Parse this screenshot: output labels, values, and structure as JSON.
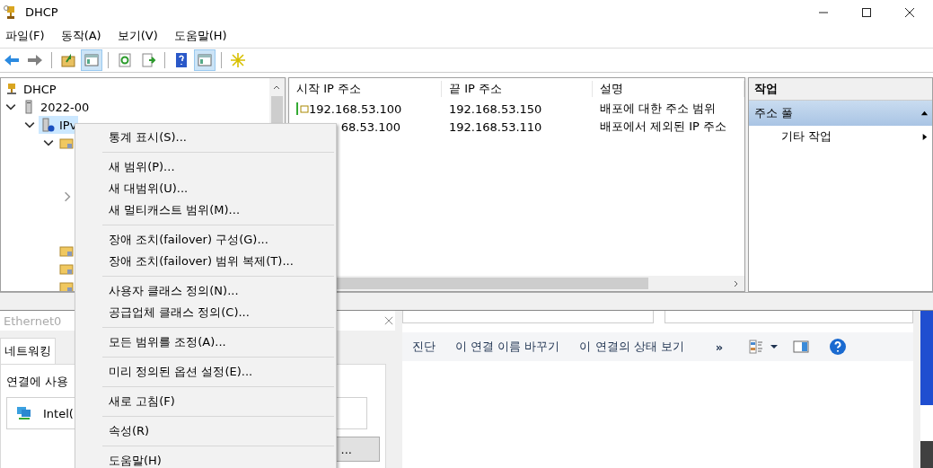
{
  "window": {
    "title": "DHCP"
  },
  "menu_bar": [
    "파일(F)",
    "동작(A)",
    "보기(V)",
    "도움말(H)"
  ],
  "toolbar": [
    {
      "pressed": false
    },
    {
      "pressed": false
    },
    {
      "pressed": false
    },
    {
      "pressed": true
    },
    {
      "pressed": false
    },
    {
      "pressed": false
    },
    {
      "pressed": false
    },
    {
      "pressed": true
    },
    {
      "pressed": false
    }
  ],
  "tree": [
    {
      "kind": "dhcp",
      "label": "DHCP",
      "children": [
        {
          "kind": "server",
          "label": "2022-00",
          "expanded": true,
          "children": [
            {
              "kind": "ipv4",
              "label": "IPv",
              "expanded": true,
              "selected": true,
              "children": [
                {
                  "kind": "folder",
                  "expanded": true,
                  "children": [
                    {
                      "expanded": false
                    }
                  ]
                },
                {
                  "kind": "folder"
                },
                {
                  "kind": "folder"
                },
                {
                  "kind": "folder"
                }
              ]
            }
          ]
        }
      ]
    }
  ],
  "list": {
    "columns": [
      "시작 IP 주소",
      "끝 IP 주소",
      "설명"
    ],
    "rows": [
      {
        "icon": true,
        "cells": [
          "192.168.53.100",
          "192.168.53.150",
          "배포에 대한 주소 범위"
        ]
      },
      {
        "icon": false,
        "cells": [
          "68.53.100",
          "192.168.53.110",
          "배포에서 제외된 IP 주소"
        ]
      }
    ]
  },
  "actions": {
    "title": "작업",
    "sections": [
      {
        "label": "주소 풀",
        "expanded": true,
        "items": [
          {
            "label": "기타 작업"
          }
        ]
      }
    ]
  },
  "context_menu": {
    "groups": [
      [
        "통계 표시(S)..."
      ],
      [
        "새 범위(P)...",
        "새 대범위(U)...",
        "새 멀티캐스트 범위(M)..."
      ],
      [
        "장애 조치(failover) 구성(G)...",
        "장애 조치(failover) 범위 복제(T)..."
      ],
      [
        "사용자 클래스 정의(N)...",
        "공급업체 클래스 정의(C)..."
      ],
      [
        "모든 범위를 조정(A)..."
      ],
      [
        "미리 정의된 옵션 설정(E)..."
      ],
      [
        "새로 고침(F)"
      ],
      [
        "속성(R)"
      ],
      [
        "도움말(H)"
      ]
    ]
  },
  "properties_dialog": {
    "title": "Ethernet0",
    "tabs": [
      {
        "label": "네트워킹",
        "selected": true
      }
    ],
    "connect_label": "연결에 사용",
    "adapter": "Intel(",
    "button": "..."
  },
  "connections_window": {
    "commands": [
      "진단",
      "이 연결 이름 바꾸기",
      "이 연결의 상태 보기"
    ],
    "more": "»"
  }
}
